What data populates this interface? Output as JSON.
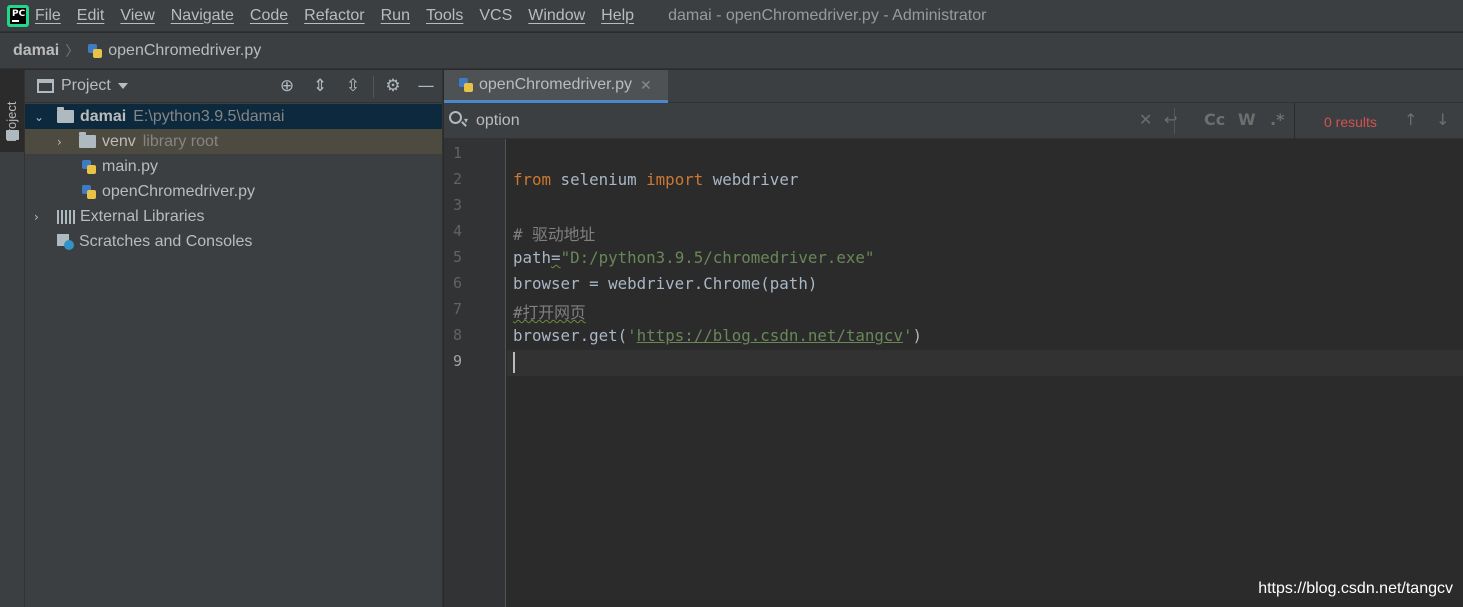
{
  "menubar": {
    "app_icon_text": "PC",
    "items": [
      "File",
      "Edit",
      "View",
      "Navigate",
      "Code",
      "Refactor",
      "Run",
      "Tools",
      "VCS",
      "Window",
      "Help"
    ],
    "window_title": "damai - openChromedriver.py - Administrator"
  },
  "breadcrumb": {
    "root": "damai",
    "separator": "〉",
    "file": "openChromedriver.py"
  },
  "left_strip": {
    "project_label": "Project"
  },
  "project_panel": {
    "title": "Project",
    "tree": {
      "root_name": "damai",
      "root_path": "E:\\python3.9.5\\damai",
      "venv_name": "venv",
      "venv_note": "library root",
      "file1": "main.py",
      "file2": "openChromedriver.py",
      "external": "External Libraries",
      "scratches": "Scratches and Consoles"
    }
  },
  "editor": {
    "tab_label": "openChromedriver.py",
    "search": {
      "value": "option",
      "results": "0 results",
      "case_label": "Cc",
      "words_label": "W",
      "regex_label": ".*"
    },
    "line_numbers": [
      "1",
      "2",
      "3",
      "4",
      "5",
      "6",
      "7",
      "8",
      "9"
    ],
    "code": {
      "l2_kw1": "from",
      "l2_mod": " selenium ",
      "l2_kw2": "import",
      "l2_name": " webdriver",
      "l4": "# 驱动地址",
      "l5_var": "path",
      "l5_eq": "=",
      "l5_str": "\"D:/python3.9.5/chromedriver.exe\"",
      "l6": "browser = webdriver.Chrome(path)",
      "l7": "#打开网页",
      "l8_pre": "browser.get(",
      "l8_q1": "'",
      "l8_url": "https://blog.csdn.net/tangcv",
      "l8_q2": "'",
      "l8_post": ")"
    }
  },
  "watermark": "https://blog.csdn.net/tangcv",
  "colors": {
    "keyword": "#cc7832",
    "string": "#6a8759",
    "comment": "#808080",
    "default_code": "#a9b7c6",
    "results_red": "#d25252",
    "tab_underline": "#4a88c7",
    "selected_row": "#0d293e"
  }
}
